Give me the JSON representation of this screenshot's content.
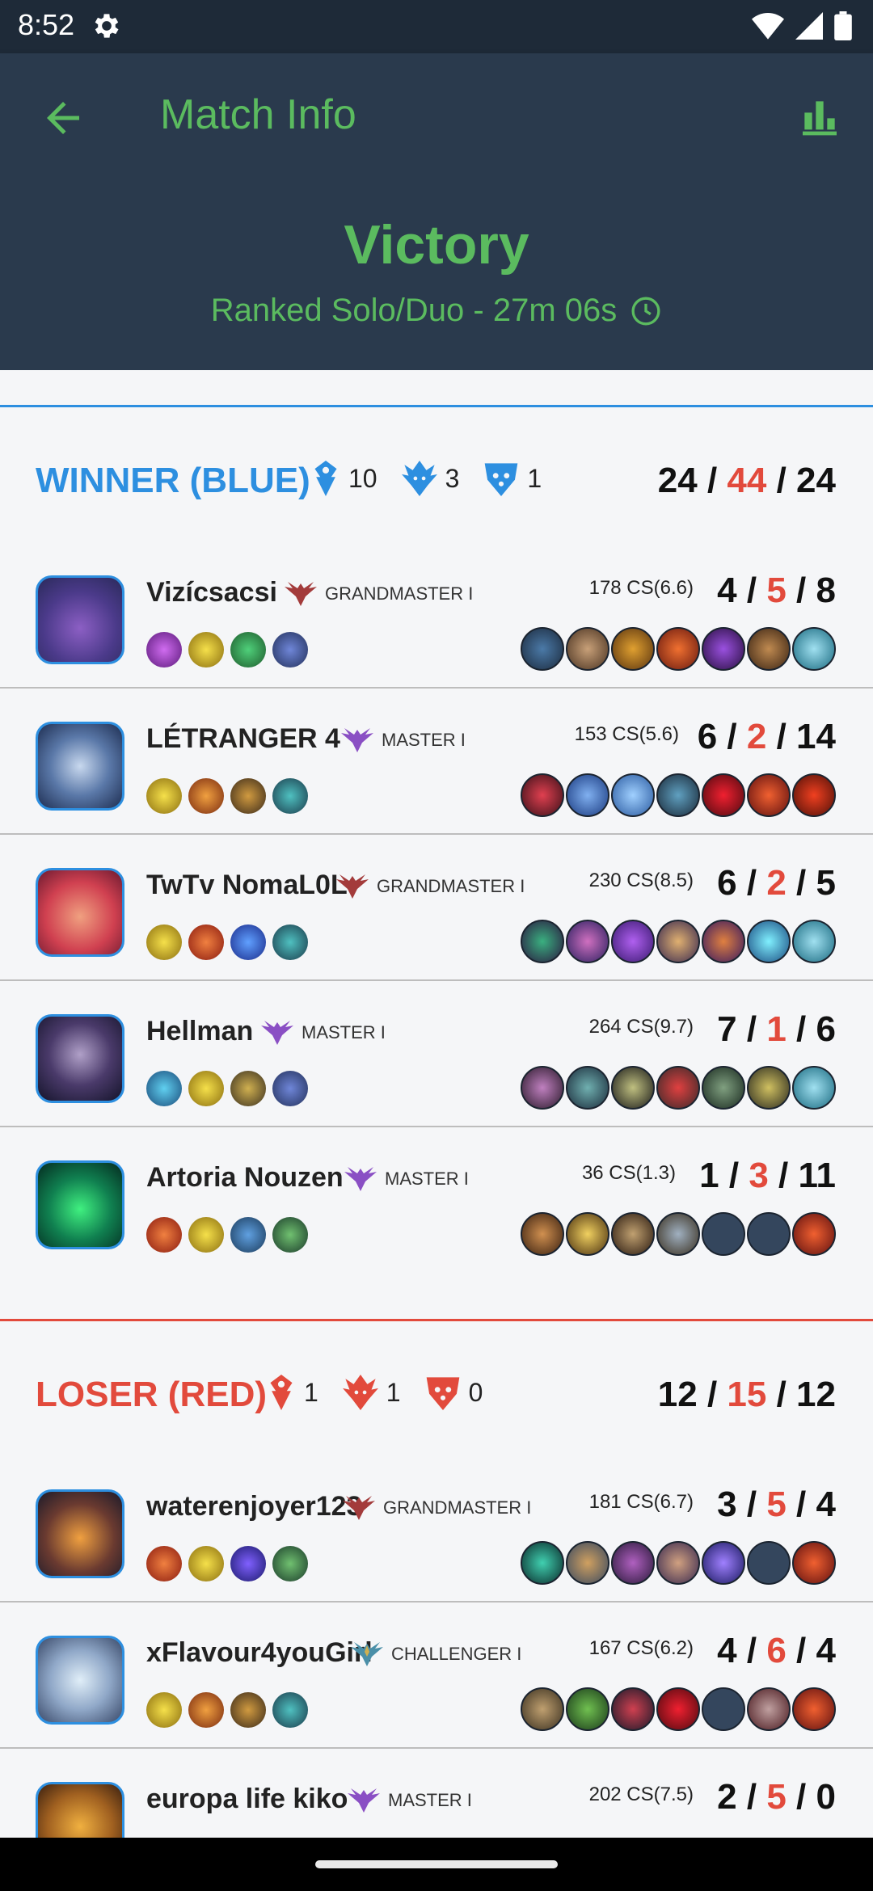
{
  "status": {
    "time": "8:52"
  },
  "app_bar": {
    "title": "Match Info"
  },
  "result": {
    "title": "Victory",
    "subtitle": "Ranked Solo/Duo - 27m 06s"
  },
  "colors": {
    "blue": "#2d8fe0",
    "red": "#e24a3c",
    "green": "#5bbb5f",
    "dark": "#2a3a4d"
  },
  "teams": [
    {
      "name": "WINNER (BLUE)",
      "objectives": [
        "10",
        "3",
        "1"
      ],
      "kda": {
        "k": "24",
        "d": "44",
        "a": "24"
      },
      "players": [
        {
          "name": "Vizícsacsi",
          "rank": "GRANDMASTER I",
          "cs": "178 CS(6.6)",
          "k": "4",
          "d": "5",
          "a": "8"
        },
        {
          "name": "LÉTRANGER 4",
          "rank": "MASTER I",
          "cs": "153 CS(5.6)",
          "k": "6",
          "d": "2",
          "a": "14"
        },
        {
          "name": "TwTv NomaL0L",
          "rank": "GRANDMASTER I",
          "cs": "230 CS(8.5)",
          "k": "6",
          "d": "2",
          "a": "5"
        },
        {
          "name": "Hellman",
          "rank": "MASTER I",
          "cs": "264 CS(9.7)",
          "k": "7",
          "d": "1",
          "a": "6"
        },
        {
          "name": "Artoria Nouzen",
          "rank": "MASTER I",
          "cs": "36 CS(1.3)",
          "k": "1",
          "d": "3",
          "a": "11"
        }
      ]
    },
    {
      "name": "LOSER (RED)",
      "objectives": [
        "1",
        "1",
        "0"
      ],
      "kda": {
        "k": "12",
        "d": "15",
        "a": "12"
      },
      "players": [
        {
          "name": "waterenjoyer123",
          "rank": "GRANDMASTER I",
          "cs": "181 CS(6.7)",
          "k": "3",
          "d": "5",
          "a": "4"
        },
        {
          "name": "xFlavour4youGirl",
          "rank": "CHALLENGER I",
          "cs": "167 CS(6.2)",
          "k": "4",
          "d": "6",
          "a": "4"
        },
        {
          "name": "europa life kiko",
          "rank": "MASTER I",
          "cs": "202 CS(7.5)",
          "k": "2",
          "d": "5",
          "a": "0"
        }
      ]
    }
  ]
}
